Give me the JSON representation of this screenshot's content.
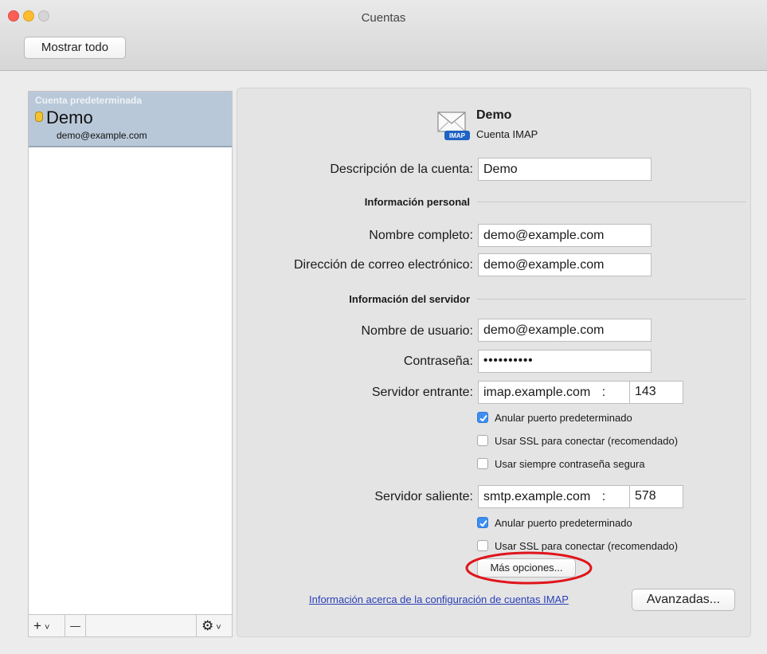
{
  "window": {
    "title": "Cuentas",
    "show_all": "Mostrar todo",
    "lights": {
      "close": "#fc5f57",
      "minimize": "#fdbd2e",
      "zoom": "#d0d0d0"
    }
  },
  "sidebar": {
    "section_label": "Cuenta predeterminada",
    "account_name": "Demo",
    "account_email": "demo@example.com",
    "footer": {
      "add": "+",
      "add_chevron": "˅",
      "remove": "—",
      "gear": "⚙",
      "gear_chevron": "˅"
    }
  },
  "account": {
    "name": "Demo",
    "type": "Cuenta IMAP",
    "badge": "IMAP"
  },
  "form": {
    "description": {
      "label": "Descripción de la cuenta:",
      "value": "Demo"
    },
    "personal_header": "Información personal",
    "full_name": {
      "label": "Nombre completo:",
      "value": "demo@example.com"
    },
    "email": {
      "label": "Dirección de correo electrónico:",
      "value": "demo@example.com"
    },
    "server_header": "Información del servidor",
    "username": {
      "label": "Nombre de usuario:",
      "value": "demo@example.com"
    },
    "password": {
      "label": "Contraseña:",
      "value": "••••••••••"
    },
    "incoming": {
      "label": "Servidor entrante:",
      "host": "imap.example.com",
      "sep": ":",
      "port": "143",
      "override_port": {
        "label": "Anular puerto predeterminado",
        "checked": true
      },
      "use_ssl": {
        "label": "Usar SSL para conectar (recomendado)",
        "checked": false
      },
      "secure_password": {
        "label": "Usar siempre contraseña segura",
        "checked": false
      }
    },
    "outgoing": {
      "label": "Servidor saliente:",
      "host": "smtp.example.com",
      "sep": ":",
      "port": "578",
      "override_port": {
        "label": "Anular puerto predeterminado",
        "checked": true
      },
      "use_ssl": {
        "label": "Usar SSL para conectar (recomendado)",
        "checked": false
      }
    },
    "more_options": "Más opciones...",
    "info_link": "Información acerca de la configuración de cuentas IMAP",
    "advanced": "Avanzadas..."
  },
  "colors": {
    "highlight_ring": "#e0141c",
    "link": "#2a3fb8",
    "checkbox_on": "#3d8ef0",
    "selection": "#b9c8d9"
  }
}
